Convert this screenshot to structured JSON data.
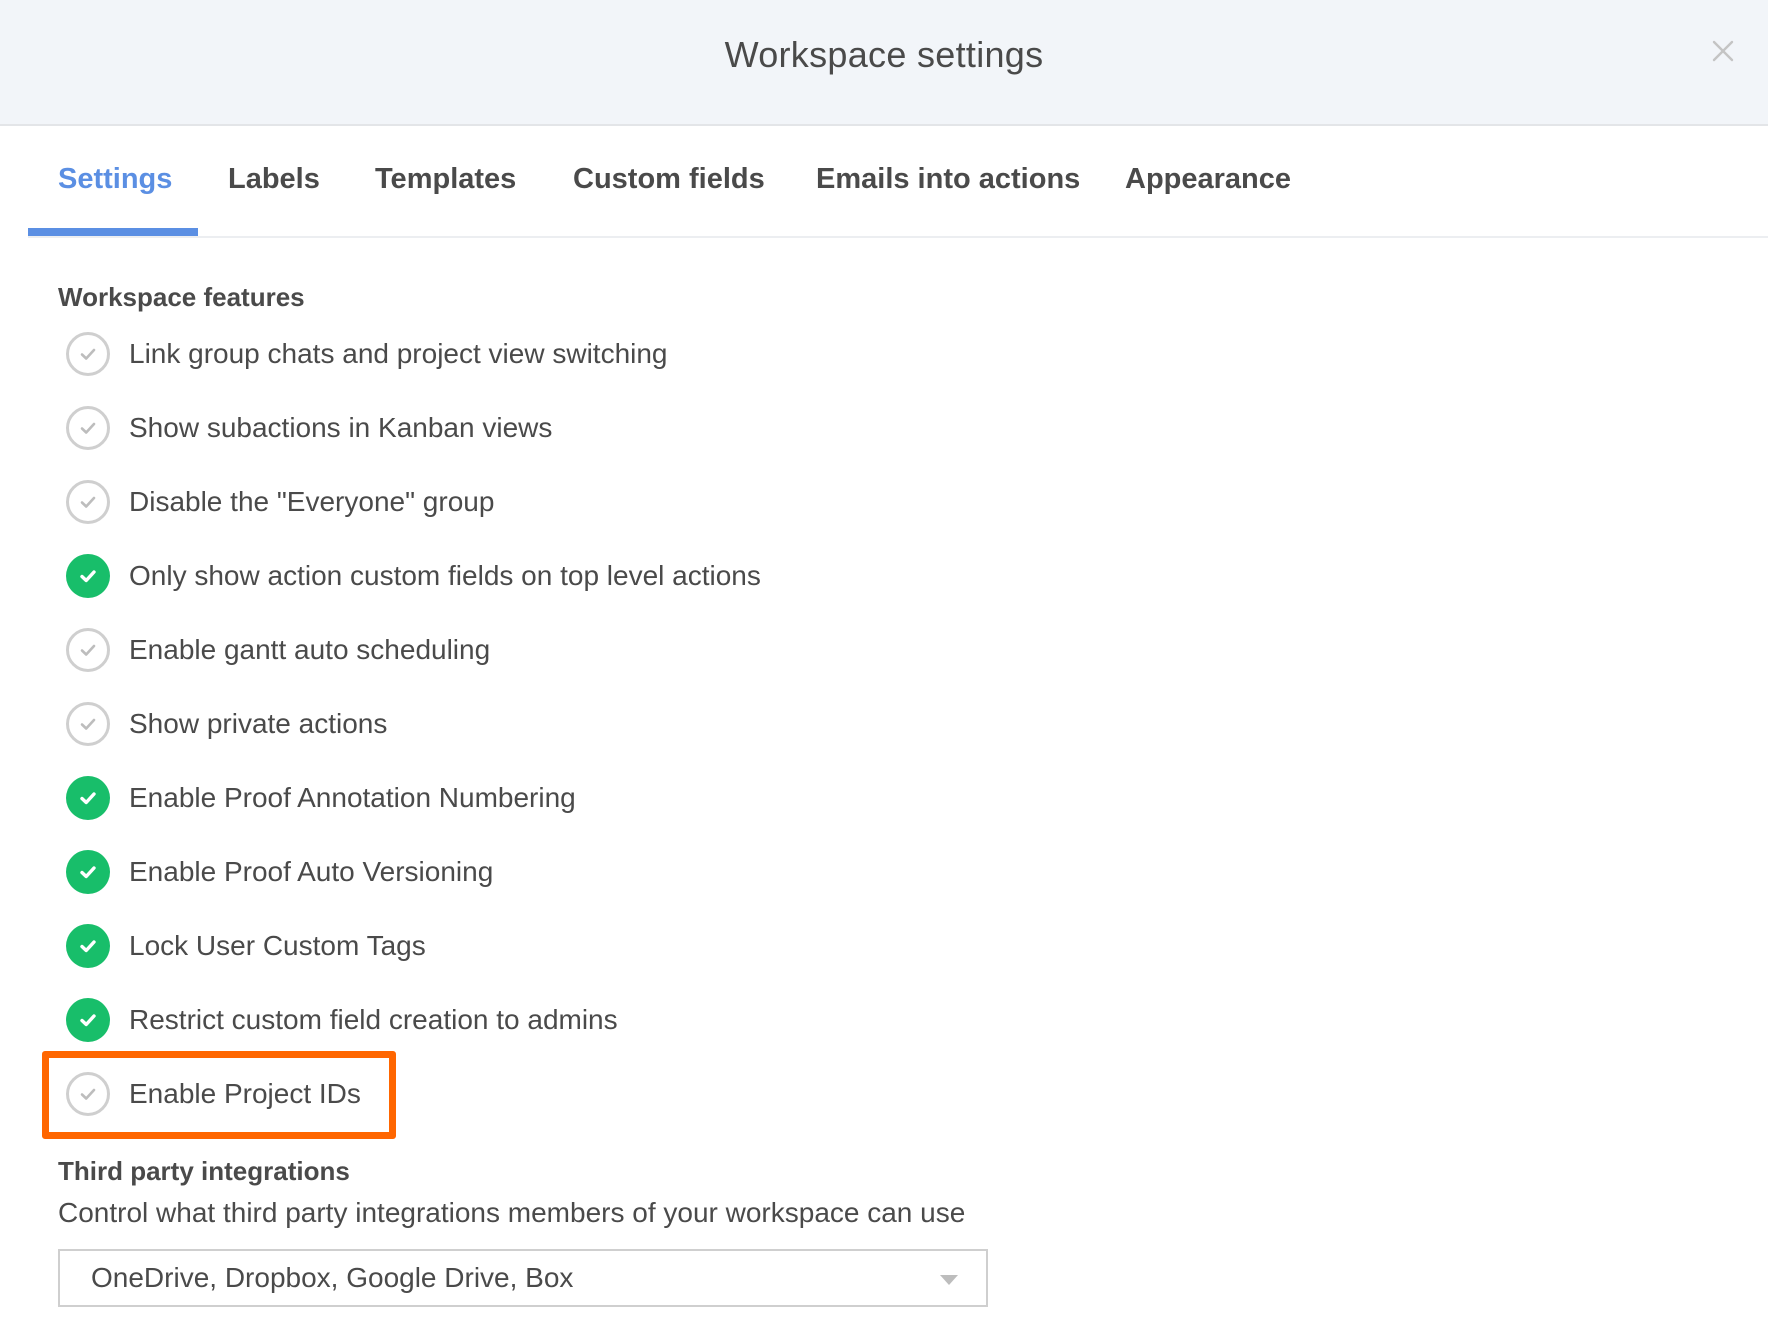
{
  "header": {
    "title": "Workspace settings",
    "close_icon": "close-icon"
  },
  "tabs": [
    {
      "label": "Settings",
      "active": true
    },
    {
      "label": "Labels",
      "active": false
    },
    {
      "label": "Templates",
      "active": false
    },
    {
      "label": "Custom fields",
      "active": false
    },
    {
      "label": "Emails into actions",
      "active": false
    },
    {
      "label": "Appearance",
      "active": false
    }
  ],
  "workspace_features": {
    "title": "Workspace features",
    "items": [
      {
        "label": "Link group chats and project view switching",
        "enabled": false
      },
      {
        "label": "Show subactions in Kanban views",
        "enabled": false
      },
      {
        "label": "Disable the \"Everyone\" group",
        "enabled": false
      },
      {
        "label": "Only show action custom fields on top level actions",
        "enabled": true
      },
      {
        "label": "Enable gantt auto scheduling",
        "enabled": false
      },
      {
        "label": "Show private actions",
        "enabled": false
      },
      {
        "label": "Enable Proof Annotation Numbering",
        "enabled": true
      },
      {
        "label": "Enable Proof Auto Versioning",
        "enabled": true
      },
      {
        "label": "Lock User Custom Tags",
        "enabled": true
      },
      {
        "label": "Restrict custom field creation to admins",
        "enabled": true
      },
      {
        "label": "Enable Project IDs",
        "enabled": false,
        "highlighted": true
      }
    ]
  },
  "third_party": {
    "title": "Third party integrations",
    "description": "Control what third party integrations members of your workspace can use",
    "selected_value": "OneDrive, Dropbox, Google Drive, Box"
  },
  "colors": {
    "accent": "#5b8fe3",
    "enabled": "#18be6a",
    "highlight": "#ff6600",
    "header_bg": "#f2f5f9"
  }
}
